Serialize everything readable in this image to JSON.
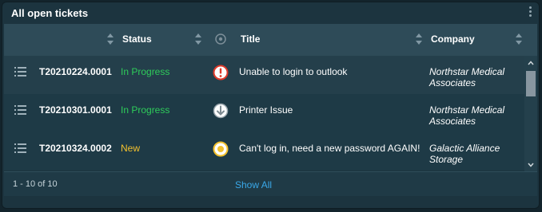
{
  "widget": {
    "title": "All open tickets",
    "menu_icon": "kebab-menu-icon"
  },
  "columns": [
    {
      "label": "",
      "sortable": true
    },
    {
      "label": "Status",
      "sortable": true
    },
    {
      "label": "",
      "icon": "priority-circle-icon"
    },
    {
      "label": "Title",
      "sortable": true
    },
    {
      "label": "Company",
      "sortable": true
    }
  ],
  "tickets": [
    {
      "id": "T20210224.0001",
      "status": "In Progress",
      "status_color": "#2ecc5a",
      "priority_icon": "exclamation-icon",
      "title": "Unable to login to outlook",
      "company": "Northstar Medical Associates"
    },
    {
      "id": "T20210301.0001",
      "status": "In Progress",
      "status_color": "#2ecc5a",
      "priority_icon": "arrow-down-icon",
      "title": "Printer Issue",
      "company": "Northstar Medical Associates"
    },
    {
      "id": "T20210324.0002",
      "status": "New",
      "status_color": "#f2c12e",
      "priority_icon": "dot-circle-icon",
      "title": "Can't log in, need a new password AGAIN!",
      "company": "Galactic Alliance Storage"
    }
  ],
  "footer": {
    "count": "1 - 10 of 10",
    "show_all": "Show All"
  },
  "colors": {
    "accent_link": "#3aa8e8",
    "status_in_progress": "#2ecc5a",
    "status_new": "#f2c12e",
    "priority_high": "#e03a2a",
    "priority_medium": "#f2c12e",
    "priority_low": "#9aa6ad"
  }
}
